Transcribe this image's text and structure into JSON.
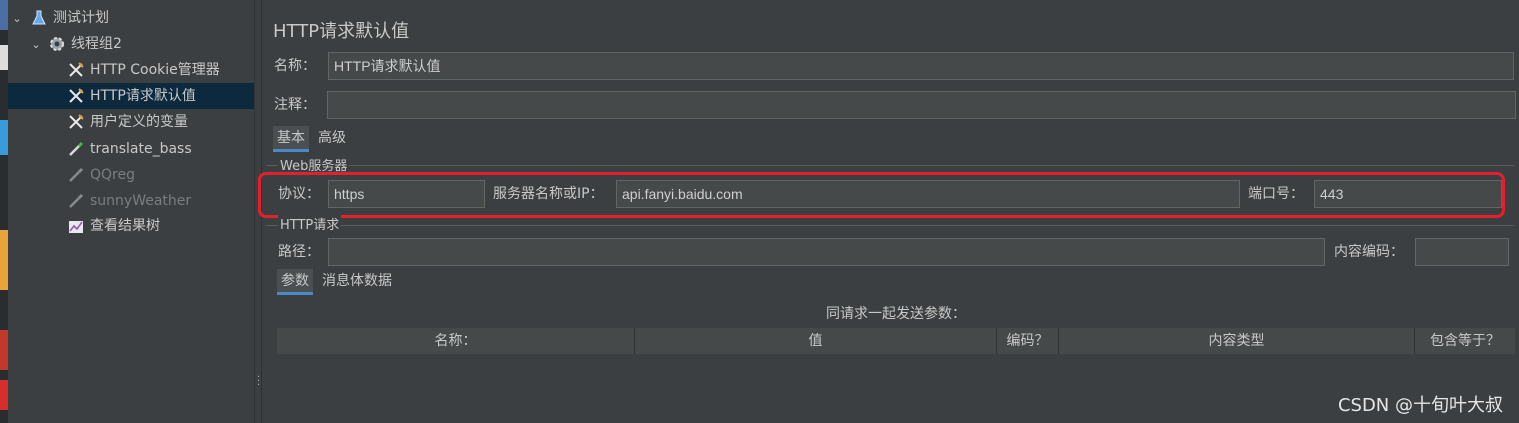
{
  "tree": {
    "items": [
      {
        "label": "测试计划",
        "icon": "flask-icon"
      },
      {
        "label": "线程组2",
        "icon": "gear-icon"
      },
      {
        "label": "HTTP Cookie管理器",
        "icon": "wrench-icon"
      },
      {
        "label": "HTTP请求默认值",
        "icon": "wrench-icon"
      },
      {
        "label": "用户定义的变量",
        "icon": "wrench-icon"
      },
      {
        "label": "translate_bass",
        "icon": "pipette-icon"
      },
      {
        "label": "QQreg",
        "icon": "pipette-icon"
      },
      {
        "label": "sunnyWeather",
        "icon": "pipette-icon"
      },
      {
        "label": "查看结果树",
        "icon": "chart-icon"
      }
    ]
  },
  "panel": {
    "title": "HTTP请求默认值",
    "name_label": "名称：",
    "name_value": "HTTP请求默认值",
    "comment_label": "注释：",
    "comment_value": "",
    "tabs": [
      "基本",
      "高级"
    ],
    "web_server": {
      "group_title": "Web服务器",
      "protocol_label": "协议：",
      "protocol_value": "https",
      "server_label": "服务器名称或IP：",
      "server_value": "api.fanyi.baidu.com",
      "port_label": "端口号：",
      "port_value": "443"
    },
    "http_request": {
      "group_title": "HTTP请求",
      "path_label": "路径：",
      "path_value": "",
      "encoding_label": "内容编码：",
      "encoding_value": "",
      "subtabs": [
        "参数",
        "消息体数据"
      ],
      "params_caption": "同请求一起发送参数：",
      "columns": [
        "名称：",
        "值",
        "编码？",
        "内容类型",
        "包含等于？"
      ]
    }
  },
  "watermark": "CSDN @十旬叶大叔",
  "colors": {
    "background": "#3c3f41",
    "selected_row": "#0d293e",
    "tab_underline": "#4a88c7",
    "highlight_box": "#e3202b"
  }
}
